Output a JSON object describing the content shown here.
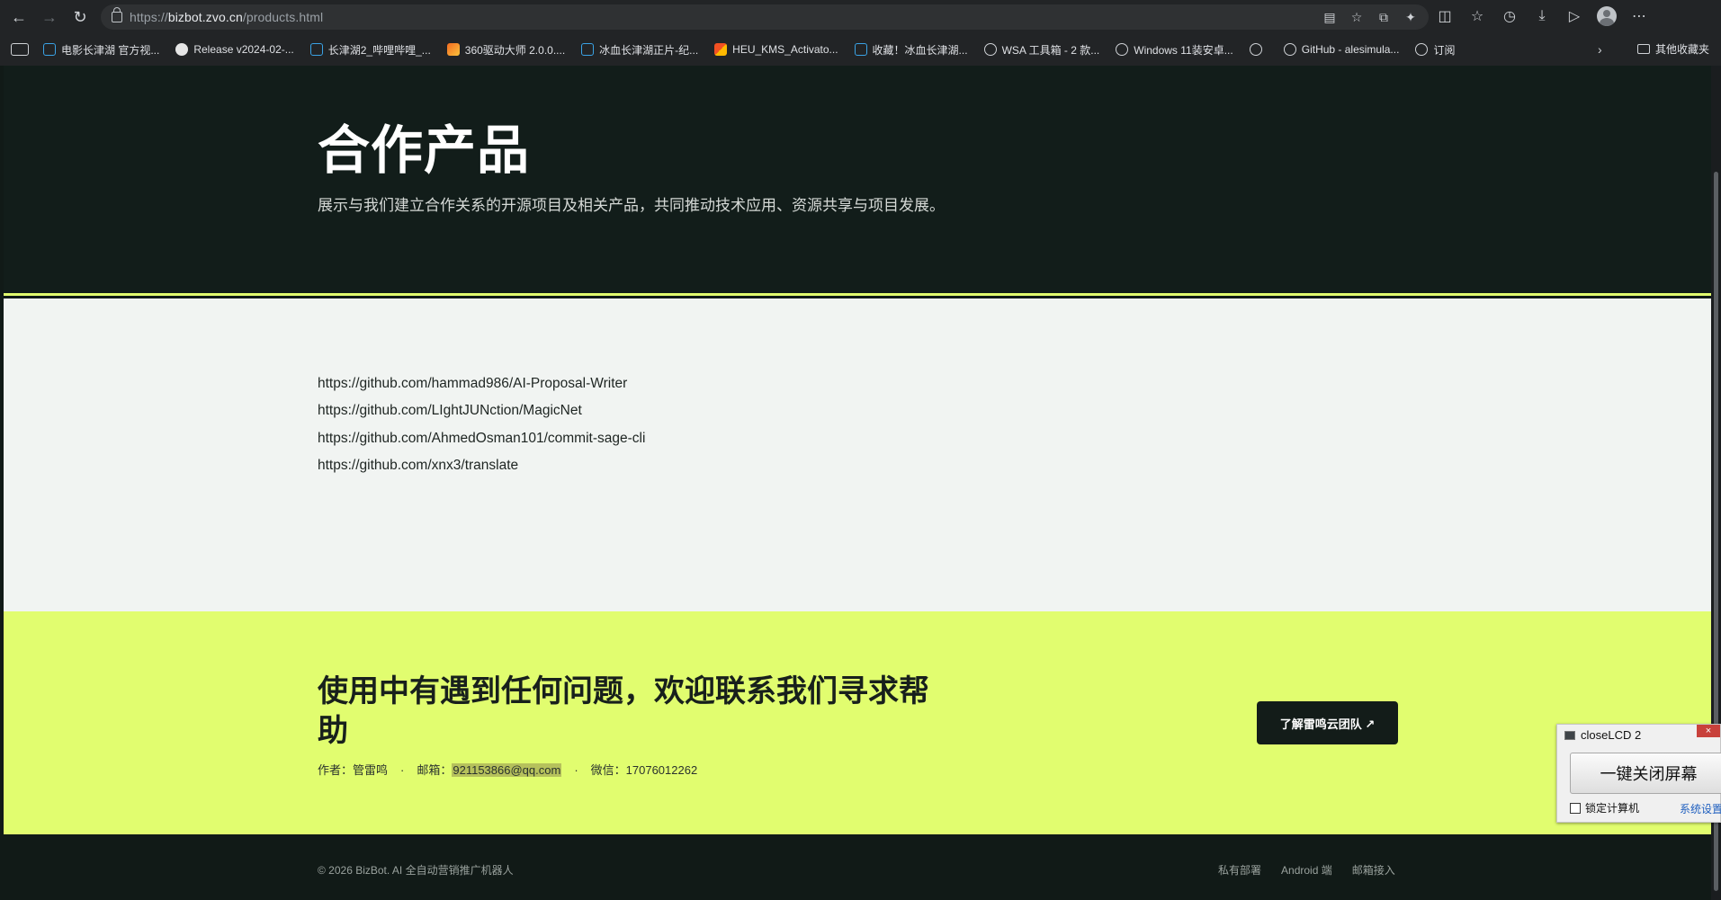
{
  "browser": {
    "url_scheme": "https://",
    "url_host": "bizbot.zvo.cn",
    "url_path": "/products.html",
    "back_glyph": "←",
    "forward_glyph": "→",
    "reload_glyph": "↻",
    "addr_icons": [
      "▤",
      "☆",
      "⧉",
      "✦"
    ],
    "right_icons": [
      "◫",
      "☆",
      "◷",
      "⤓",
      "▷",
      "⋯"
    ],
    "bookmarks": [
      {
        "label": "电影长津湖 官方视...",
        "icon": "bilibili-icon"
      },
      {
        "label": "Release v2024-02-...",
        "icon": "github-icon"
      },
      {
        "label": "长津湖2_哔哩哔哩_...",
        "icon": "bilibili-icon"
      },
      {
        "label": "360驱动大师 2.0.0....",
        "icon": "360-icon"
      },
      {
        "label": "冰血长津湖正片-纪...",
        "icon": "bilibili-icon"
      },
      {
        "label": "HEU_KMS_Activato...",
        "icon": "windows-icon"
      },
      {
        "label": "收藏！冰血长津湖...",
        "icon": "bilibili-icon"
      },
      {
        "label": "WSA 工具箱 - 2 款...",
        "icon": "globe-icon"
      },
      {
        "label": "Windows 11装安卓...",
        "icon": "globe-icon"
      },
      {
        "label": "",
        "icon": "globe-icon"
      },
      {
        "label": "GitHub - alesimula...",
        "icon": "globe-icon"
      },
      {
        "label": "订阅",
        "icon": "globe-icon"
      }
    ],
    "bookmarks_more": "›",
    "other_bookmarks": "其他收藏夹"
  },
  "hero": {
    "title": "合作产品",
    "subtitle": "展示与我们建立合作关系的开源项目及相关产品，共同推动技术应用、资源共享与项目发展。"
  },
  "links": [
    "https://github.com/hammad986/AI-Proposal-Writer",
    "https://github.com/LIghtJUNction/MagicNet",
    "https://github.com/AhmedOsman101/commit-sage-cli",
    "https://github.com/xnx3/translate"
  ],
  "contact": {
    "title": "使用中有遇到任何问题，欢迎联系我们寻求帮助",
    "author": "作者：管雷鸣",
    "email_label": "邮箱：",
    "email": "921153866@qq.com",
    "wechat": "微信：17076012262",
    "separator": "·",
    "button": "了解雷鸣云团队 ↗"
  },
  "footer": {
    "copyright": "© 2026 BizBot. AI 全自动营销推广机器人",
    "links": [
      "私有部署",
      "Android 端",
      "邮箱接入"
    ]
  },
  "widget": {
    "title": "closeLCD 2",
    "close": "×",
    "button": "一键关闭屏幕",
    "checkbox_label": "锁定计算机",
    "settings": "系统设置"
  }
}
